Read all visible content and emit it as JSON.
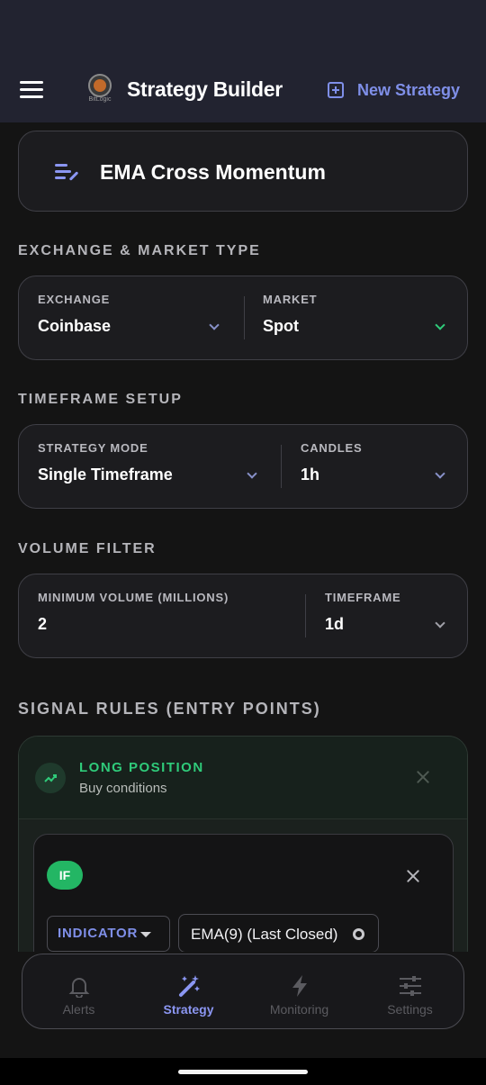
{
  "app": {
    "title": "Strategy Builder",
    "logo_text": "BitLogic",
    "new_strategy_label": "New Strategy"
  },
  "strategy": {
    "name": "EMA Cross Momentum"
  },
  "exchange_section": {
    "heading": "EXCHANGE & MARKET TYPE",
    "exchange_label": "EXCHANGE",
    "exchange_value": "Coinbase",
    "market_label": "MARKET",
    "market_value": "Spot"
  },
  "timeframe_section": {
    "heading": "TIMEFRAME SETUP",
    "mode_label": "STRATEGY MODE",
    "mode_value": "Single Timeframe",
    "candles_label": "CANDLES",
    "candles_value": "1h"
  },
  "volume_section": {
    "heading": "VOLUME FILTER",
    "min_label": "MINIMUM VOLUME (MILLIONS)",
    "min_value": "2",
    "tf_label": "TIMEFRAME",
    "tf_value": "1d"
  },
  "signal_rules": {
    "heading": "SIGNAL RULES (ENTRY POINTS)",
    "long": {
      "title": "LONG POSITION",
      "subtitle": "Buy conditions",
      "if_label": "IF",
      "operand_type": "INDICATOR",
      "operand_value": "EMA(9) (Last Closed)"
    }
  },
  "bottom_nav": {
    "items": [
      {
        "label": "Alerts",
        "icon": "bell-icon"
      },
      {
        "label": "Strategy",
        "icon": "magic-wand-icon"
      },
      {
        "label": "Monitoring",
        "icon": "lightning-icon"
      },
      {
        "label": "Settings",
        "icon": "sliders-icon"
      }
    ]
  },
  "colors": {
    "accent": "#7f8fe8",
    "long_green": "#2fcb7a",
    "if_badge": "#23b664",
    "background": "#141414",
    "header": "#222330"
  }
}
